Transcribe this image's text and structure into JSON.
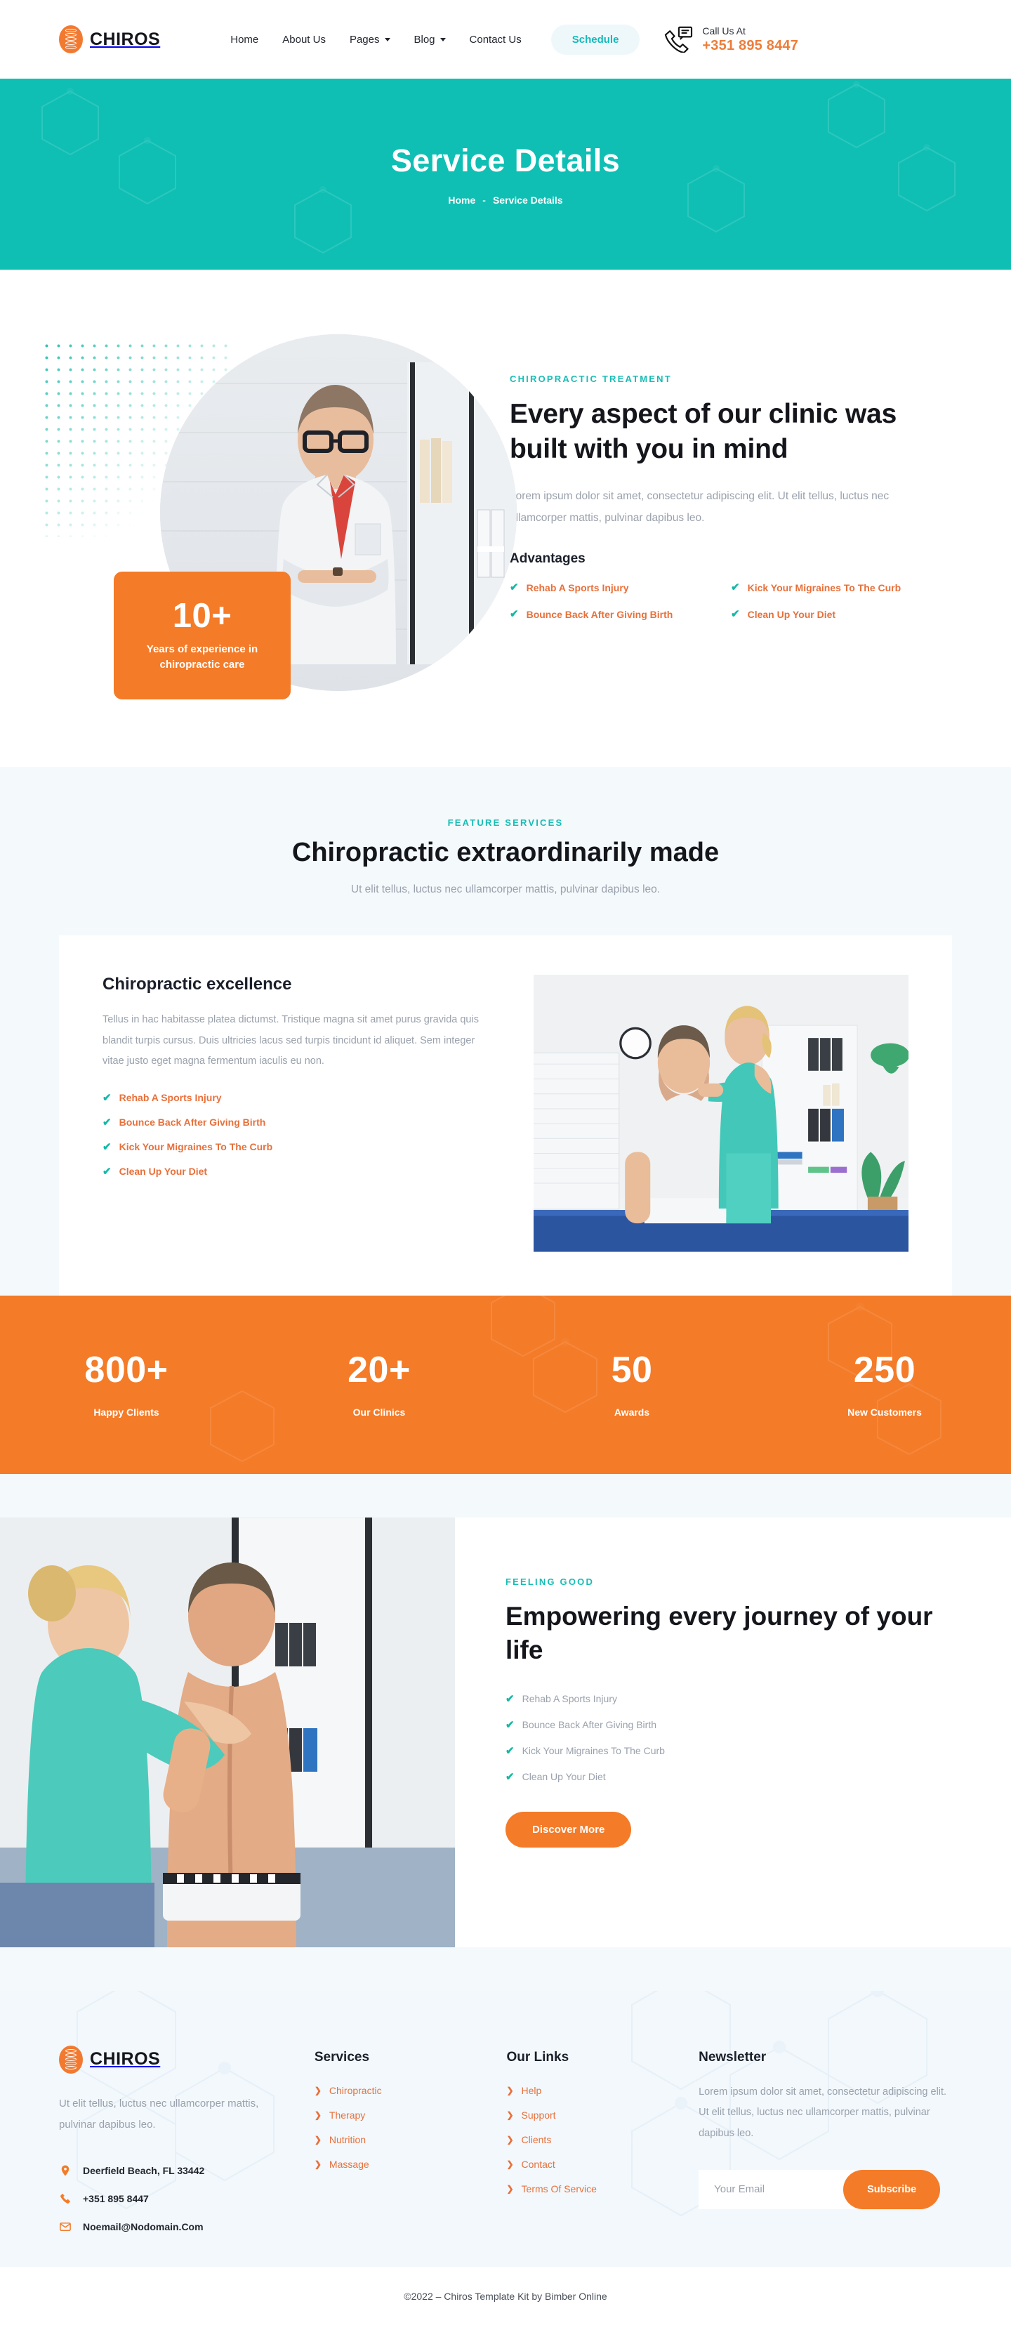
{
  "brand": {
    "name": "CHIROS",
    "logo_icon": "spine-logo-icon",
    "accent": "#F47B28"
  },
  "header": {
    "nav": [
      {
        "label": "Home",
        "has_dropdown": false
      },
      {
        "label": "About Us",
        "has_dropdown": false
      },
      {
        "label": "Pages",
        "has_dropdown": true
      },
      {
        "label": "Blog",
        "has_dropdown": true
      },
      {
        "label": "Contact Us",
        "has_dropdown": false
      }
    ],
    "schedule_label": "Schedule",
    "call_label": "Call Us At",
    "call_number": "+351 895 8447",
    "phone_icon": "phone-chat-icon"
  },
  "banner": {
    "title": "Service Details",
    "crumb_home": "Home",
    "crumb_sep": "-",
    "crumb_current": "Service Details",
    "bg": "#0FBFB4"
  },
  "about": {
    "eyebrow": "CHIROPRACTIC TREATMENT",
    "heading": "Every aspect of our clinic was built with you in mind",
    "paragraph": "Lorem ipsum dolor sit amet, consectetur adipiscing elit. Ut elit tellus, luctus nec ullamcorper mattis, pulvinar dapibus leo.",
    "advantages_title": "Advantages",
    "advantages": [
      "Rehab A Sports Injury",
      "Kick Your Migraines To The Curb",
      "Bounce Back After Giving Birth",
      "Clean Up Your Diet"
    ],
    "badge_number": "10+",
    "badge_caption": "Years of experience in chiropractic care"
  },
  "feature": {
    "eyebrow": "FEATURE SERVICES",
    "heading": "Chiropractic extraordinarily made",
    "subtitle": "Ut elit tellus, luctus nec ullamcorper mattis, pulvinar dapibus leo.",
    "card_title": "Chiropractic excellence",
    "card_paragraph": "Tellus in hac habitasse platea dictumst. Tristique magna sit amet purus gravida quis blandit turpis cursus. Duis ultricies lacus sed turpis tincidunt id aliquet. Sem integer vitae justo eget magna fermentum iaculis eu non.",
    "card_list": [
      "Rehab A Sports Injury",
      "Bounce Back After Giving Birth",
      "Kick Your Migraines To The Curb",
      "Clean Up Your Diet"
    ]
  },
  "counters": {
    "bg": "#F47B28",
    "items": [
      {
        "value": "800+",
        "label": "Happy Clients"
      },
      {
        "value": "20+",
        "label": "Our Clinics"
      },
      {
        "value": "50",
        "label": "Awards"
      },
      {
        "value": "250",
        "label": "New Customers"
      }
    ]
  },
  "empower": {
    "eyebrow": "FEELING GOOD",
    "heading": "Empowering every journey of your life",
    "list": [
      "Rehab A Sports Injury",
      "Bounce Back After Giving Birth",
      "Kick Your Migraines To The Curb",
      "Clean Up Your Diet"
    ],
    "cta_label": "Discover More"
  },
  "footer": {
    "about_text": "Ut elit tellus, luctus nec ullamcorper mattis, pulvinar dapibus leo.",
    "address": "Deerfield Beach, FL 33442",
    "phone": "+351 895 8447",
    "email": "Noemail@Nodomain.Com",
    "services_title": "Services",
    "services": [
      "Chiropractic",
      "Therapy",
      "Nutrition",
      "Massage"
    ],
    "links_title": "Our Links",
    "links": [
      "Help",
      "Support",
      "Clients",
      "Contact",
      "Terms Of Service"
    ],
    "newsletter_title": "Newsletter",
    "newsletter_text": "Lorem ipsum dolor sit amet, consectetur adipiscing elit. Ut elit tellus, luctus nec ullamcorper mattis, pulvinar dapibus leo.",
    "email_placeholder": "Your Email",
    "email_value": "",
    "subscribe_label": "Subscribe",
    "copyright": "©2022 – Chiros Template Kit by Bimber Online"
  }
}
